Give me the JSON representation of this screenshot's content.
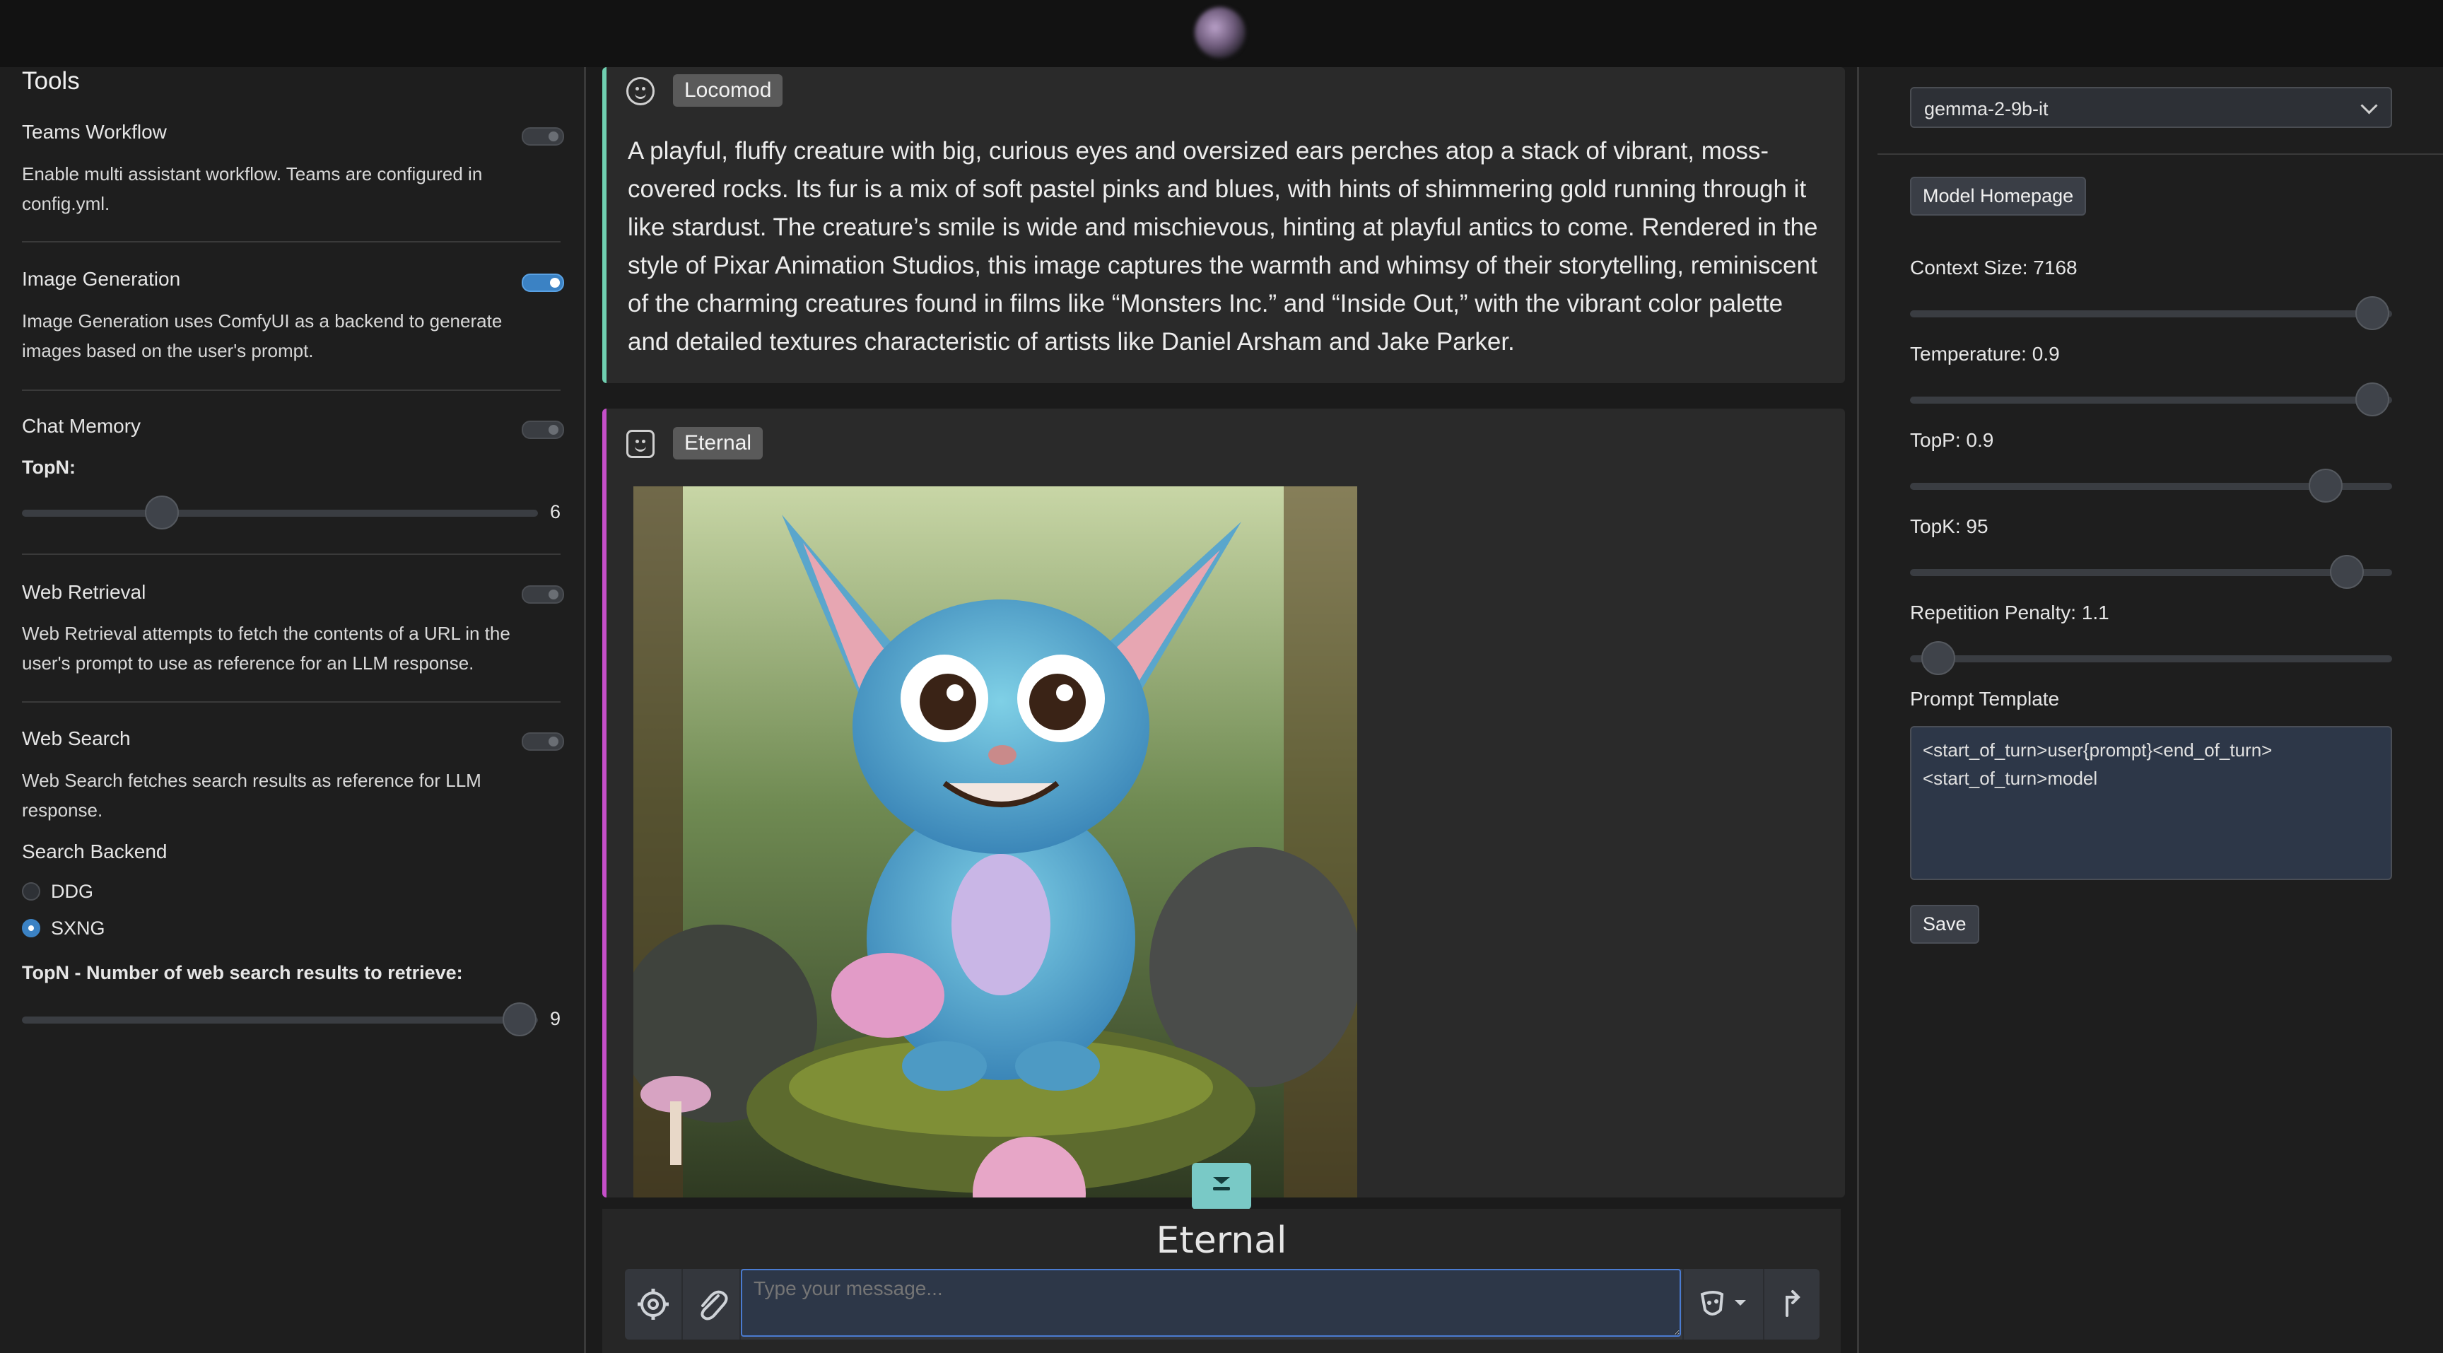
{
  "left": {
    "title": "Tools",
    "teams": {
      "label": "Teams Workflow",
      "desc": "Enable multi assistant workflow. Teams are configured in config.yml.",
      "enabled": false
    },
    "image_gen": {
      "label": "Image Generation",
      "desc": "Image Generation uses ComfyUI as a backend to generate images based on the user's prompt.",
      "enabled": true
    },
    "chat_memory": {
      "label": "Chat Memory",
      "enabled": false,
      "topn_label": "TopN:",
      "topn_value": "6"
    },
    "web_retrieval": {
      "label": "Web Retrieval",
      "desc": "Web Retrieval attempts to fetch the contents of a URL in the user's prompt to use as reference for an LLM response.",
      "enabled": false
    },
    "web_search": {
      "label": "Web Search",
      "desc": "Web Search fetches search results as reference for LLM response.",
      "enabled": false
    },
    "search_backend": {
      "label": "Search Backend",
      "options": [
        "DDG",
        "SXNG"
      ],
      "selected": "SXNG"
    },
    "results": {
      "label": "TopN - Number of web search results to retrieve:",
      "value": "9"
    }
  },
  "chat": {
    "msg1": {
      "author": "Locomod",
      "text": " A playful, fluffy creature with big, curious eyes and oversized ears perches atop a stack of vibrant, moss-covered rocks. Its fur is a mix of soft pastel pinks and blues, with hints of shimmering gold running through it like stardust. The creature’s smile is wide and mischievous, hinting at playful antics to come. Rendered in the style of Pixar Animation Studios, this image captures the warmth and whimsy of their storytelling, reminiscent of the charming creatures found in films like “Monsters Inc.” and “Inside Out,” with the vibrant color palette and detailed textures characteristic of artists like Daniel Arsham and Jake Parker."
    },
    "msg2": {
      "author": "Eternal"
    },
    "brand": "Eternal",
    "placeholder": "Type your message..."
  },
  "right": {
    "model": "gemma-2-9b-it",
    "homepage_btn": "Model Homepage",
    "context": {
      "label": "Context Size: 7168",
      "value": 7168,
      "max": 8192
    },
    "temperature": {
      "label": "Temperature: 0.9",
      "value": 0.9
    },
    "topp": {
      "label": "TopP: 0.9",
      "value": 0.9
    },
    "topk": {
      "label": "TopK: 95",
      "value": 95
    },
    "rep": {
      "label": "Repetition Penalty: 1.1",
      "value": 1.1
    },
    "template_label": "Prompt Template",
    "template": "<start_of_turn>user{prompt}<end_of_turn>\n<start_of_turn>model",
    "save_btn": "Save"
  },
  "colors": {
    "accent": "#3b82c4",
    "user_bar": "#6fcfb0",
    "assistant_bar": "#c54fc9",
    "scroll_btn": "#79c9c6"
  },
  "icons": [
    "settings-gear-icon",
    "paperclip-icon",
    "theater-masks-icon",
    "caret-up-icon",
    "send-arrow-icon",
    "chevron-down-icon",
    "double-chevron-down-icon",
    "smiley-icon"
  ]
}
